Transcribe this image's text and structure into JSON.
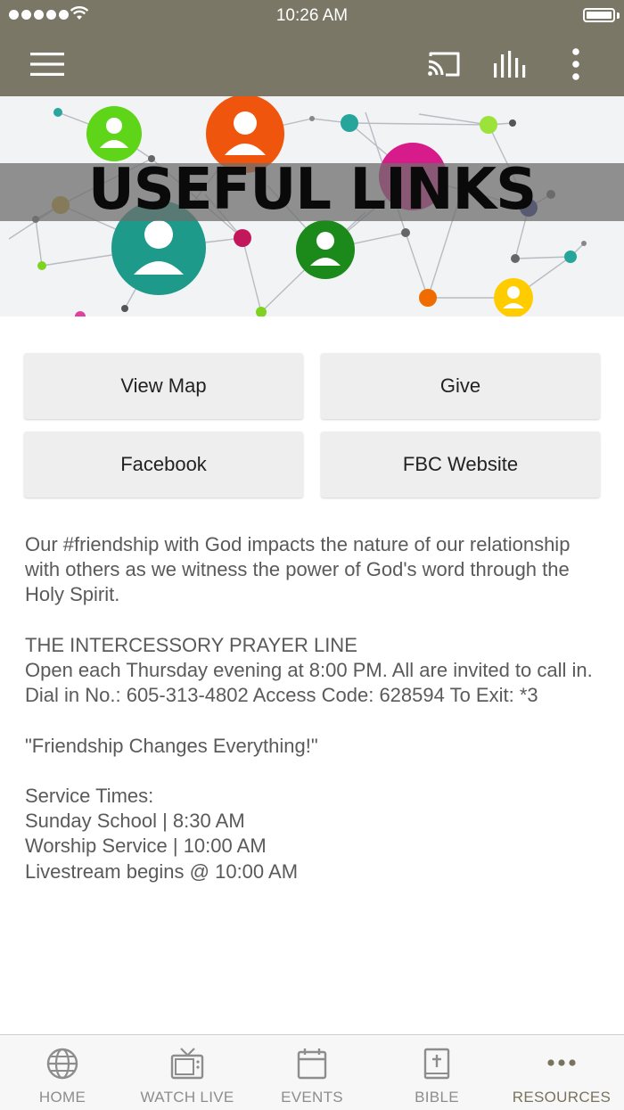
{
  "status_bar": {
    "time": "10:26 AM"
  },
  "banner": {
    "title": "USEFUL LINKS"
  },
  "buttons": [
    {
      "label": "View Map"
    },
    {
      "label": "Give"
    },
    {
      "label": "Facebook"
    },
    {
      "label": "FBC Website"
    }
  ],
  "content": {
    "intro": "Our #friendship with God impacts the nature of our relationship with others as we witness the power of God's word through the Holy Spirit.",
    "prayer_heading": "THE INTERCESSORY PRAYER LINE",
    "prayer_text": "Open each Thursday evening at 8:00 PM. All are invited to call in.",
    "dial_text": "Dial in No.: 605-313-4802 Access Code: 628594 To Exit: *3",
    "quote": "\"Friendship Changes Everything!\"",
    "service_heading": "Service Times:",
    "service_lines": [
      "Sunday School | 8:30 AM",
      "Worship Service | 10:00 AM",
      "Livestream begins @ 10:00 AM"
    ]
  },
  "tabs": [
    {
      "label": "HOME",
      "icon": "globe-icon"
    },
    {
      "label": "WATCH LIVE",
      "icon": "tv-icon"
    },
    {
      "label": "EVENTS",
      "icon": "calendar-icon"
    },
    {
      "label": "BIBLE",
      "icon": "bible-icon"
    },
    {
      "label": "RESOURCES",
      "icon": "more-dots-icon"
    }
  ],
  "colors": {
    "header": "#7a7766",
    "active_tab": "#77735f",
    "inactive_tab": "#8d8d8d",
    "button_bg": "#eeeeef"
  }
}
